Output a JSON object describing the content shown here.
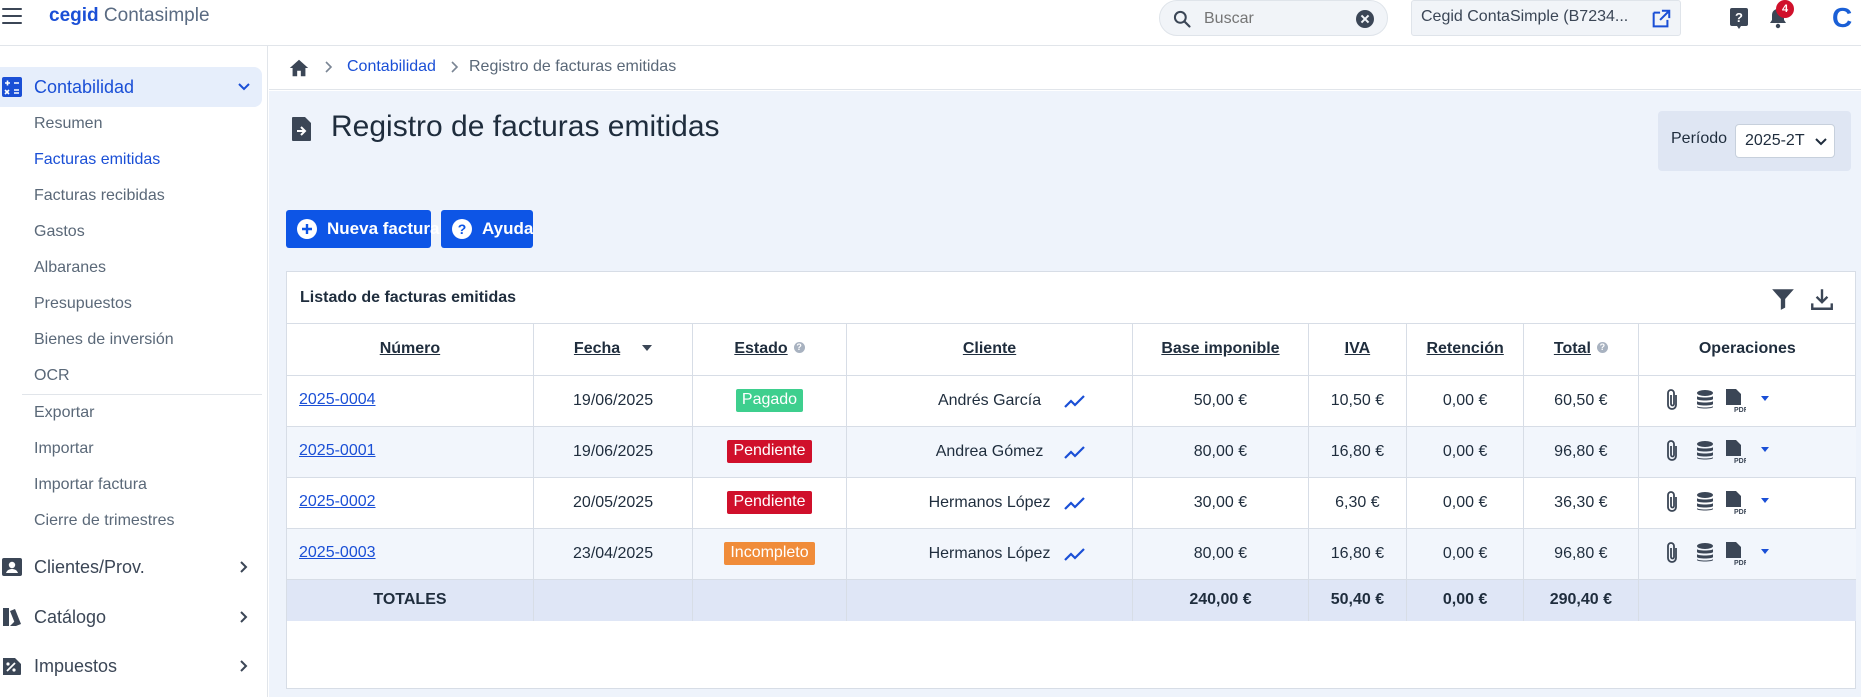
{
  "app": {
    "brand_bold": "cegid",
    "brand_light": "Contasimple",
    "search_placeholder": "Buscar",
    "company": "Cegid ContaSimple (B7234...",
    "notifications_count": "4",
    "app_letter": "C"
  },
  "sidebar": {
    "contabilidad": {
      "label": "Contabilidad",
      "items": [
        {
          "label": "Resumen"
        },
        {
          "label": "Facturas emitidas"
        },
        {
          "label": "Facturas recibidas"
        },
        {
          "label": "Gastos"
        },
        {
          "label": "Albaranes"
        },
        {
          "label": "Presupuestos"
        },
        {
          "label": "Bienes de inversión"
        },
        {
          "label": "OCR"
        },
        {
          "label": "Exportar"
        },
        {
          "label": "Importar"
        },
        {
          "label": "Importar factura"
        },
        {
          "label": "Cierre de trimestres"
        }
      ]
    },
    "sections": [
      {
        "label": "Clientes/Prov."
      },
      {
        "label": "Catálogo"
      },
      {
        "label": "Impuestos"
      }
    ]
  },
  "breadcrumb": {
    "items": [
      "Contabilidad",
      "Registro de facturas emitidas"
    ]
  },
  "page": {
    "title": "Registro de facturas emitidas",
    "periodo_label": "Período",
    "periodo_value": "2025-2T",
    "new_invoice": "Nueva factura",
    "help": "Ayuda"
  },
  "table": {
    "title": "Listado de facturas emitidas",
    "headers": {
      "numero": "Número",
      "fecha": "Fecha",
      "estado": "Estado",
      "cliente": "Cliente",
      "base": "Base imponible",
      "iva": "IVA",
      "retencion": "Retención",
      "total": "Total",
      "operaciones": "Operaciones"
    },
    "rows": [
      {
        "numero": "2025-0004",
        "fecha": "19/06/2025",
        "estado": "Pagado",
        "cliente": "Andrés García",
        "base": "50,00 €",
        "iva": "10,50 €",
        "retencion": "0,00 €",
        "total": "60,50 €"
      },
      {
        "numero": "2025-0001",
        "fecha": "19/06/2025",
        "estado": "Pendiente",
        "cliente": "Andrea Gómez",
        "base": "80,00 €",
        "iva": "16,80 €",
        "retencion": "0,00 €",
        "total": "96,80 €"
      },
      {
        "numero": "2025-0002",
        "fecha": "20/05/2025",
        "estado": "Pendiente",
        "cliente": "Hermanos López",
        "base": "30,00 €",
        "iva": "6,30 €",
        "retencion": "0,00 €",
        "total": "36,30 €"
      },
      {
        "numero": "2025-0003",
        "fecha": "23/04/2025",
        "estado": "Incompleto",
        "cliente": "Hermanos López",
        "base": "80,00 €",
        "iva": "16,80 €",
        "retencion": "0,00 €",
        "total": "96,80 €"
      }
    ],
    "totals": {
      "label": "TOTALES",
      "base": "240,00 €",
      "iva": "50,40 €",
      "retencion": "0,00 €",
      "total": "290,40 €"
    }
  },
  "colors": {
    "accent": "#0d55e6",
    "link": "#1a4fd6",
    "pagado": "#3ecf8e",
    "pendiente": "#d0102b",
    "incompleto": "#f08c3a"
  }
}
